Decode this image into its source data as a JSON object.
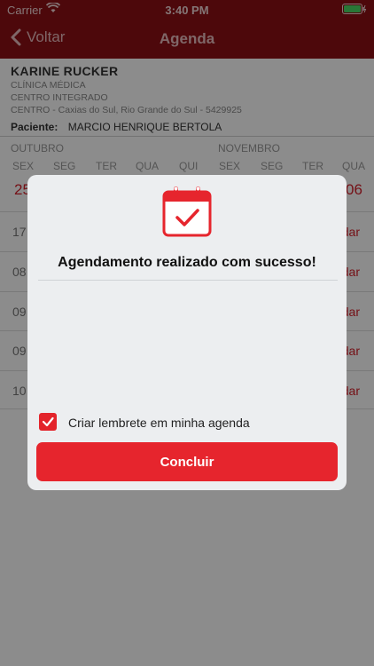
{
  "status": {
    "carrier": "Carrier",
    "time": "3:40 PM"
  },
  "nav": {
    "back_label": "Voltar",
    "title": "Agenda"
  },
  "info": {
    "doctor": "KARINE RUCKER",
    "specialty": "CLÍNICA MÉDICA",
    "clinic": "CENTRO INTEGRADO",
    "address": "CENTRO - Caxias do Sul, Rio Grande do Sul - 5429925",
    "patient_label": "Paciente:",
    "patient_name": "MARCIO HENRIQUE BERTOLA"
  },
  "calendar": {
    "months": [
      "OUTUBRO",
      "NOVEMBRO"
    ],
    "weekdays": [
      "SEX",
      "SEG",
      "TER",
      "QUA",
      "QUI",
      "SEX",
      "SEG",
      "TER",
      "QUA"
    ],
    "dates": [
      "25",
      "06"
    ]
  },
  "slots": [
    {
      "time": "17",
      "action": "dar"
    },
    {
      "time": "08",
      "action": "dar"
    },
    {
      "time": "09",
      "action": "dar"
    },
    {
      "time": "09",
      "action": "dar"
    },
    {
      "time": "10",
      "action": "dar"
    }
  ],
  "dialog": {
    "message": "Agendamento realizado com sucesso!",
    "reminder_label": "Criar lembrete em minha agenda",
    "reminder_checked": true,
    "confirm_label": "Concluir"
  },
  "colors": {
    "brand": "#8c1014",
    "accent": "#e6252d"
  }
}
